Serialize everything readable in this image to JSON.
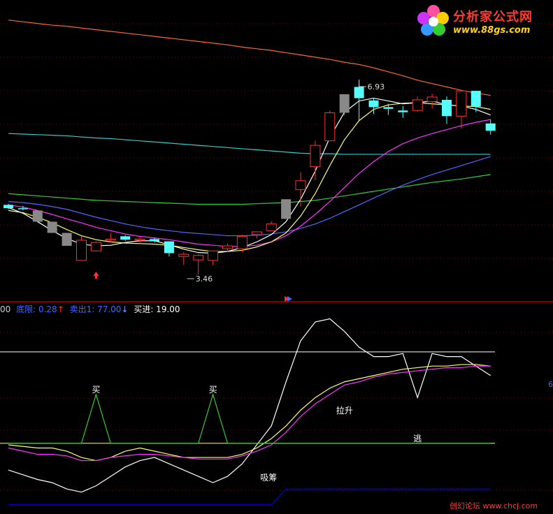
{
  "watermark": {
    "site_name": "分析家公式网",
    "site_url": "www.88gs.com",
    "footer": "创幻论坛 www.chcj.com"
  },
  "colors": {
    "background": "#000000",
    "up_candle": "#ff3030",
    "down_candle": "#55ffff",
    "white_line": "#ffffff",
    "yellow_line": "#ffff66",
    "magenta_line": "#ff33ff",
    "blue_line": "#5566ff",
    "green_line": "#33cc33",
    "cyan_line": "#33cccc",
    "orange_line": "#ff6633",
    "grid": "#880000",
    "navy_line": "#0000cc"
  },
  "legend": {
    "item0": "00",
    "item1": "底限: 0.28",
    "item1_arrow": "↑",
    "item2": "卖出1: 77.00",
    "item2_arrow": "↓",
    "item3": "买进: 19.00",
    "right_edge": "6"
  },
  "chart_data": [
    {
      "type": "candlestick",
      "title": "",
      "annotations": [
        {
          "text": "6.93",
          "kind": "high"
        },
        {
          "text": "3.46",
          "kind": "low"
        }
      ],
      "candles": [
        {
          "o": 4.7,
          "h": 4.72,
          "l": 4.62,
          "c": 4.64
        },
        {
          "o": 4.64,
          "h": 4.68,
          "l": 4.6,
          "c": 4.63
        },
        {
          "o": 4.6,
          "h": 4.6,
          "l": 4.4,
          "c": 4.4,
          "limit": true
        },
        {
          "o": 4.4,
          "h": 4.4,
          "l": 4.2,
          "c": 4.2,
          "limit": true
        },
        {
          "o": 4.2,
          "h": 4.2,
          "l": 3.97,
          "c": 3.97,
          "limit": true
        },
        {
          "o": 3.71,
          "h": 4.14,
          "l": 3.71,
          "c": 4.07
        },
        {
          "o": 3.88,
          "h": 4.05,
          "l": 3.88,
          "c": 4.03
        },
        {
          "o": 4.07,
          "h": 4.2,
          "l": 4.03,
          "c": 4.09
        },
        {
          "o": 4.14,
          "h": 4.16,
          "l": 4.06,
          "c": 4.08
        },
        {
          "o": 4.07,
          "h": 4.12,
          "l": 4.03,
          "c": 4.09
        },
        {
          "o": 4.09,
          "h": 4.12,
          "l": 4.03,
          "c": 4.05
        },
        {
          "o": 4.05,
          "h": 4.05,
          "l": 3.78,
          "c": 3.84
        },
        {
          "o": 3.78,
          "h": 3.86,
          "l": 3.63,
          "c": 3.82
        },
        {
          "o": 3.72,
          "h": 3.82,
          "l": 3.46,
          "c": 3.8
        },
        {
          "o": 3.71,
          "h": 3.88,
          "l": 3.63,
          "c": 3.88
        },
        {
          "o": 3.92,
          "h": 4.01,
          "l": 3.86,
          "c": 3.97
        },
        {
          "o": 3.92,
          "h": 4.17,
          "l": 3.86,
          "c": 4.14
        },
        {
          "o": 4.17,
          "h": 4.22,
          "l": 4.1,
          "c": 4.22
        },
        {
          "o": 4.24,
          "h": 4.41,
          "l": 4.24,
          "c": 4.36
        },
        {
          "o": 4.45,
          "h": 4.8,
          "l": 4.45,
          "c": 4.8,
          "limit": true
        },
        {
          "o": 4.97,
          "h": 5.28,
          "l": 4.67,
          "c": 5.13
        },
        {
          "o": 5.38,
          "h": 5.84,
          "l": 5.14,
          "c": 5.76
        },
        {
          "o": 5.84,
          "h": 6.38,
          "l": 5.84,
          "c": 6.34
        },
        {
          "o": 6.34,
          "h": 6.67,
          "l": 6.3,
          "c": 6.67,
          "limit": true
        },
        {
          "o": 6.8,
          "h": 6.93,
          "l": 6.2,
          "c": 6.6
        },
        {
          "o": 6.56,
          "h": 6.6,
          "l": 6.32,
          "c": 6.44
        },
        {
          "o": 6.44,
          "h": 6.5,
          "l": 6.3,
          "c": 6.41
        },
        {
          "o": 6.38,
          "h": 6.46,
          "l": 6.25,
          "c": 6.35
        },
        {
          "o": 6.38,
          "h": 6.63,
          "l": 6.36,
          "c": 6.57
        },
        {
          "o": 6.54,
          "h": 6.68,
          "l": 6.42,
          "c": 6.62
        },
        {
          "o": 6.57,
          "h": 6.63,
          "l": 6.14,
          "c": 6.28
        },
        {
          "o": 6.28,
          "h": 6.74,
          "l": 6.06,
          "c": 6.73
        },
        {
          "o": 6.73,
          "h": 6.73,
          "l": 6.35,
          "c": 6.45
        },
        {
          "o": 6.15,
          "h": 6.22,
          "l": 5.95,
          "c": 6.02
        }
      ],
      "moving_averages": [
        {
          "color_key": "orange_line",
          "values": [
            7.99,
            7.96,
            7.93,
            7.9,
            7.88,
            7.85,
            7.82,
            7.79,
            7.76,
            7.73,
            7.7,
            7.67,
            7.64,
            7.61,
            7.58,
            7.55,
            7.51,
            7.48,
            7.45,
            7.41,
            7.37,
            7.33,
            7.29,
            7.24,
            7.2,
            7.14,
            7.07,
            7.0,
            6.92,
            6.86,
            6.8,
            6.74,
            6.69,
            6.65
          ]
        },
        {
          "color_key": "cyan_line",
          "values": [
            5.97,
            5.96,
            5.95,
            5.94,
            5.93,
            5.91,
            5.89,
            5.88,
            5.86,
            5.84,
            5.82,
            5.8,
            5.78,
            5.76,
            5.74,
            5.72,
            5.7,
            5.68,
            5.66,
            5.64,
            5.62,
            5.61,
            5.61,
            5.6,
            5.6,
            5.6,
            5.6,
            5.6,
            5.6,
            5.6,
            5.6,
            5.6,
            5.6,
            5.6
          ]
        },
        {
          "color_key": "green_line",
          "values": [
            4.9,
            4.88,
            4.86,
            4.84,
            4.82,
            4.8,
            4.78,
            4.77,
            4.76,
            4.75,
            4.74,
            4.73,
            4.72,
            4.71,
            4.71,
            4.71,
            4.71,
            4.72,
            4.73,
            4.74,
            4.76,
            4.78,
            4.82,
            4.86,
            4.9,
            4.94,
            4.98,
            5.02,
            5.06,
            5.1,
            5.13,
            5.16,
            5.2,
            5.24
          ]
        },
        {
          "color_key": "blue_line",
          "values": [
            4.76,
            4.74,
            4.71,
            4.67,
            4.62,
            4.55,
            4.48,
            4.42,
            4.36,
            4.31,
            4.27,
            4.24,
            4.21,
            4.19,
            4.17,
            4.15,
            4.15,
            4.16,
            4.18,
            4.22,
            4.28,
            4.36,
            4.46,
            4.58,
            4.7,
            4.82,
            4.94,
            5.05,
            5.15,
            5.24,
            5.32,
            5.4,
            5.48,
            5.56
          ]
        },
        {
          "color_key": "magenta_line",
          "values": [
            4.7,
            4.66,
            4.6,
            4.53,
            4.45,
            4.38,
            4.3,
            4.24,
            4.18,
            4.14,
            4.11,
            4.08,
            4.04,
            4.0,
            3.98,
            3.96,
            3.96,
            3.98,
            4.04,
            4.15,
            4.32,
            4.53,
            4.76,
            5.01,
            5.26,
            5.47,
            5.65,
            5.79,
            5.89,
            5.97,
            6.04,
            6.11,
            6.17,
            6.22
          ]
        },
        {
          "color_key": "yellow_line",
          "values": [
            4.6,
            4.56,
            4.48,
            4.38,
            4.26,
            4.15,
            4.08,
            4.04,
            4.02,
            4.01,
            4.0,
            3.98,
            3.94,
            3.9,
            3.87,
            3.87,
            3.89,
            3.95,
            4.04,
            4.2,
            4.5,
            4.9,
            5.4,
            5.86,
            6.2,
            6.4,
            6.48,
            6.51,
            6.52,
            6.5,
            6.48,
            6.46,
            6.45,
            6.4
          ]
        },
        {
          "color_key": "white_line",
          "values": [
            4.65,
            4.55,
            4.4,
            4.24,
            4.1,
            4.0,
            3.97,
            3.98,
            4.03,
            4.06,
            4.06,
            3.99,
            3.91,
            3.85,
            3.84,
            3.87,
            3.94,
            4.04,
            4.17,
            4.4,
            4.8,
            5.3,
            5.9,
            6.35,
            6.55,
            6.6,
            6.55,
            6.5,
            6.52,
            6.55,
            6.48,
            6.46,
            6.4,
            6.3
          ]
        }
      ]
    },
    {
      "type": "line",
      "title": "",
      "labels": [
        {
          "text": "买",
          "point": 6
        },
        {
          "text": "买",
          "point": 14
        },
        {
          "text": "吸筹",
          "point": 18
        },
        {
          "text": "拉升",
          "point": 23
        },
        {
          "text": "逃",
          "point": 28
        }
      ],
      "reference_lines": [
        {
          "y": 77.0,
          "color_key": "white_line"
        },
        {
          "y": 19.0,
          "color_key": "yellow_line"
        }
      ],
      "series": [
        {
          "color_key": "white_line",
          "values": [
            2,
            -1,
            -4,
            -6,
            -10,
            -12,
            -8,
            -2,
            4,
            8,
            10,
            6,
            2,
            -2,
            -6,
            -2,
            6,
            18,
            30,
            58,
            84,
            96,
            98,
            90,
            80,
            74,
            74,
            76,
            48,
            76,
            74,
            74,
            68,
            62
          ]
        },
        {
          "color_key": "yellow_line",
          "values": [
            18,
            17,
            16,
            16,
            14,
            10,
            8,
            10,
            14,
            16,
            14,
            12,
            10,
            10,
            10,
            10,
            12,
            16,
            22,
            30,
            40,
            48,
            54,
            58,
            60,
            62,
            64,
            66,
            67,
            68,
            68,
            69,
            69,
            68
          ]
        },
        {
          "color_key": "magenta_line",
          "values": [
            16,
            14,
            12,
            12,
            11,
            8,
            8,
            10,
            11,
            12,
            12,
            11,
            10,
            9,
            9,
            9,
            11,
            14,
            18,
            26,
            36,
            44,
            50,
            56,
            58,
            61,
            63,
            64,
            65,
            66,
            67,
            67,
            68,
            68
          ]
        },
        {
          "color_key": "green_line",
          "values": [
            19,
            19,
            19,
            19,
            19,
            19,
            50,
            19,
            19,
            19,
            19,
            19,
            19,
            19,
            50,
            19,
            19,
            19,
            19,
            19,
            19,
            19,
            19,
            19,
            19,
            19,
            19,
            19,
            19,
            19,
            19,
            19,
            19,
            19
          ]
        },
        {
          "color_key": "navy_line",
          "values": [
            -20,
            -20,
            -20,
            -20,
            -20,
            -20,
            -20,
            -20,
            -20,
            -20,
            -20,
            -20,
            -20,
            -20,
            -20,
            -20,
            -20,
            -20,
            -20,
            -10,
            -10,
            -10,
            -10,
            -10,
            -10,
            -10,
            -10,
            -10,
            -10,
            -10,
            -10,
            -10,
            -10,
            -10
          ]
        }
      ]
    }
  ]
}
